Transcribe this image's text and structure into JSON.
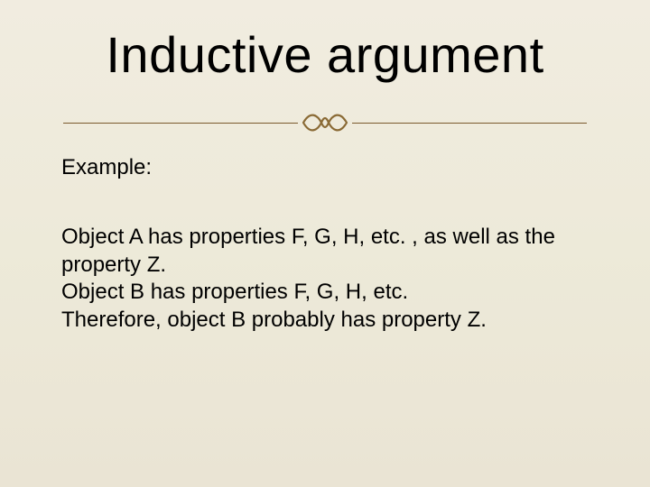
{
  "slide": {
    "title": "Inductive argument",
    "example_label": "Example:",
    "body": {
      "line1": "Object A has properties F, G, H, etc. , as well as the property Z.",
      "line2": "Object B has properties F, G, H, etc.",
      "line3": "Therefore, object B probably has property Z."
    },
    "accent_color": "#8a6a35"
  }
}
